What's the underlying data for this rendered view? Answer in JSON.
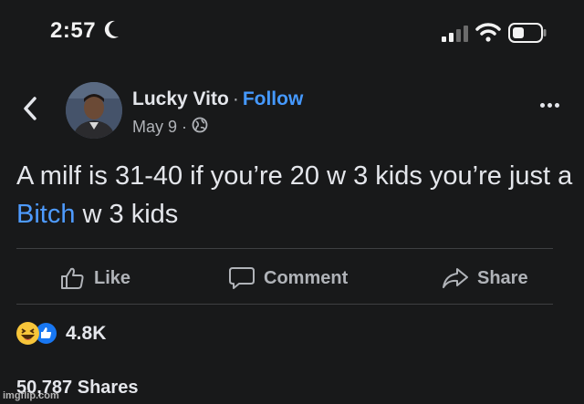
{
  "status_bar": {
    "time": "2:57",
    "moon": "moon-icon",
    "signal": "cell-signal-icon",
    "wifi": "wifi-icon",
    "battery": "battery-icon"
  },
  "post": {
    "author": "Lucky Vito",
    "separator": "·",
    "follow_label": "Follow",
    "date": "May 9",
    "date_separator": "·",
    "audience_icon": "globe-icon",
    "text_part1": "A milf is 31-40 if you’re 20 w 3 kids you’re just a ",
    "text_link": "Bitch",
    "text_part2": " w 3 kids",
    "link_color": "#4e9bff"
  },
  "actions": {
    "like_label": "Like",
    "comment_label": "Comment",
    "share_label": "Share"
  },
  "reactions": {
    "icons": [
      "haha-icon",
      "like-reaction-icon"
    ],
    "count": "4.8K"
  },
  "shares": {
    "label": "50,787 Shares"
  },
  "watermark": "imgflip.com",
  "colors": {
    "background": "#18191a",
    "text": "#e4e6eb",
    "secondary": "#b0b3b8",
    "accent": "#4599ff"
  }
}
